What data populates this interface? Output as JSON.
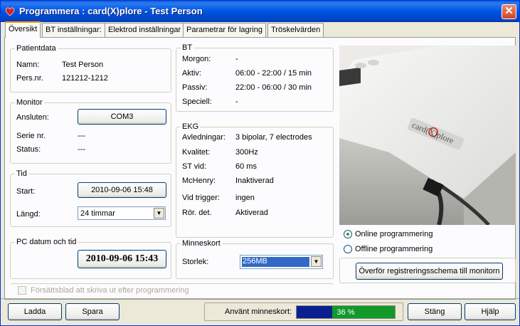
{
  "window": {
    "title": "Programmera : card(X)plore - Test Person",
    "close_glyph": "✕"
  },
  "tabs": [
    {
      "label": "Översikt"
    },
    {
      "label": "BT inställningar:"
    },
    {
      "label": "Elektrod inställningar"
    },
    {
      "label": "Parametrar för lagring"
    },
    {
      "label": "Tröskelvärden"
    }
  ],
  "patientdata": {
    "title": "Patientdata",
    "name_label": "Namn:",
    "name_value": "Test Person",
    "pnr_label": "Pers.nr.",
    "pnr_value": "121212-1212"
  },
  "monitor": {
    "title": "Monitor",
    "connected_label": "Ansluten:",
    "connected_value": "COM3",
    "serial_label": "Serie nr.",
    "serial_value": "---",
    "status_label": "Status:",
    "status_value": "---"
  },
  "tid": {
    "title": "Tid",
    "start_label": "Start:",
    "start_value": "2010-09-06 15:48",
    "length_label": "Längd:",
    "length_value": "24 timmar"
  },
  "pc_time": {
    "title": "PC datum och tid",
    "value": "2010-09-06 15:43"
  },
  "bt": {
    "title": "BT",
    "rows": [
      {
        "label": "Morgon:",
        "value": "-"
      },
      {
        "label": "Aktiv:",
        "value": "06:00 - 22:00 / 15 min"
      },
      {
        "label": "Passiv:",
        "value": "22:00 - 06:00 / 30 min"
      },
      {
        "label": "Speciell:",
        "value": "-"
      }
    ]
  },
  "ekg": {
    "title": "EKG",
    "rows": [
      {
        "label": "Avledningar:",
        "value": "3 bipolar, 7 electrodes"
      },
      {
        "label": "Kvalitet:",
        "value": "300Hz"
      },
      {
        "label": "ST vid:",
        "value": "60 ms"
      },
      {
        "label": "McHenry:",
        "value": "Inaktiverad"
      },
      {
        "label": "Vid trigger:",
        "value": "ingen"
      },
      {
        "label": "Rör. det.",
        "value": "Aktiverad"
      }
    ]
  },
  "memory": {
    "title": "Minneskort",
    "size_label": "Storlek:",
    "size_value": "256MB"
  },
  "device": {
    "brand_text": "card(X)plore"
  },
  "programming": {
    "online_label": "Online programmering",
    "offline_label": "Offline programmering",
    "selected": "online",
    "transfer_button": "Överför registreringsschema till monitorn"
  },
  "cover_checkbox": {
    "label": "Försättsblad att skriva ut efter programmering",
    "checked": false,
    "enabled": false
  },
  "bottom": {
    "load_button": "Ladda",
    "save_button": "Spara",
    "memory_used_label": "Använt minneskort:",
    "memory_used_percent": 36,
    "memory_used_text": "36 %",
    "close_button": "Stäng",
    "help_button": "Hjälp"
  },
  "colors": {
    "titlebar": "#0054e3",
    "progress_used": "#0a1f8f",
    "progress_free": "#11992a",
    "selection": "#316ac5"
  }
}
